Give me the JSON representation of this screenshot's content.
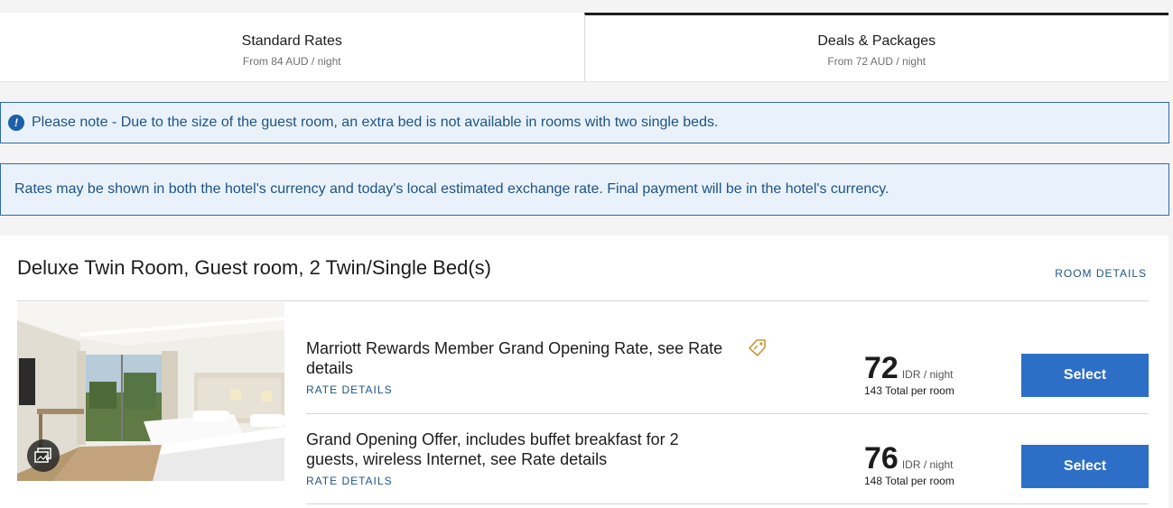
{
  "tabs": [
    {
      "title": "Standard Rates",
      "subtitle": "From 84 AUD / night",
      "active": false
    },
    {
      "title": "Deals & Packages",
      "subtitle": "From 72 AUD / night",
      "active": true
    }
  ],
  "notices": {
    "note": "Please note - Due to the size of the guest room, an extra bed is not available in rooms with two single beds.",
    "currency": "Rates may be shown in both the hotel's currency and today's local estimated exchange rate. Final payment will be in the hotel's currency.",
    "info_icon": "info-icon"
  },
  "room": {
    "title": "Deluxe Twin Room, Guest room, 2 Twin/Single Bed(s)",
    "details_link": "ROOM DETAILS",
    "gallery_icon": "gallery-icon",
    "rates": [
      {
        "name": "Marriott Rewards Member Grand Opening Rate, see Rate details",
        "details_link": "RATE DETAILS",
        "price": "72",
        "unit": "IDR / night",
        "total": "143 Total per room",
        "select_label": "Select",
        "icon": "tag-icon"
      },
      {
        "name": "Grand Opening Offer, includes buffet breakfast for 2 guests, wireless Internet, see Rate details",
        "details_link": "RATE DETAILS",
        "price": "76",
        "unit": "IDR / night",
        "total": "148 Total per room",
        "select_label": "Select"
      }
    ]
  },
  "colors": {
    "link": "#1f5385",
    "button": "#2d6fc7",
    "notice_bg": "#e9f2fa",
    "notice_border": "#2f6aa5",
    "tag": "#c9943a"
  }
}
